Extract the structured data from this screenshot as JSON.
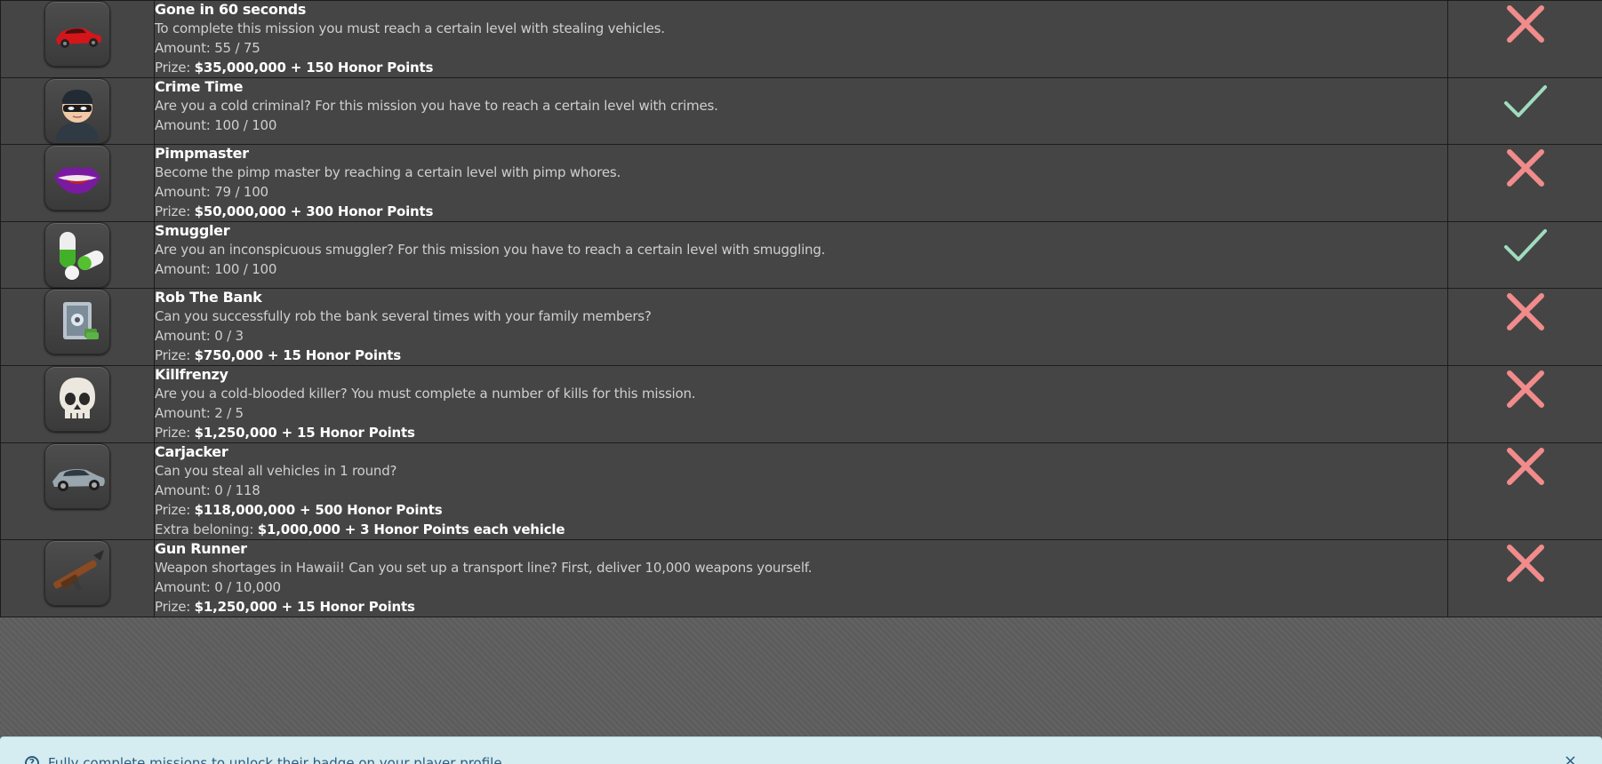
{
  "missions": [
    {
      "icon": "red-sports-car-icon",
      "title": "Gone in 60 seconds",
      "description": "To complete this mission you must reach a certain level with stealing vehicles.",
      "amount_label": "Amount:",
      "amount": "55 / 75",
      "prize_label": "Prize:",
      "prize": "$35,000,000 + 150 Honor Points",
      "status": "incomplete-x-icon"
    },
    {
      "icon": "masked-criminal-icon",
      "title": "Crime Time",
      "description": "Are you a cold criminal? For this mission you have to reach a certain level with crimes.",
      "amount_label": "Amount:",
      "amount": "100 / 100",
      "status": "complete-check-icon"
    },
    {
      "icon": "purple-lips-icon",
      "title": "Pimpmaster",
      "description": "Become the pimp master by reaching a certain level with pimp whores.",
      "amount_label": "Amount:",
      "amount": "79 / 100",
      "prize_label": "Prize:",
      "prize": "$50,000,000 + 300 Honor Points",
      "status": "incomplete-x-icon"
    },
    {
      "icon": "pills-icon",
      "title": "Smuggler",
      "description": "Are you an inconspicuous smuggler? For this mission you have to reach a certain level with smuggling.",
      "amount_label": "Amount:",
      "amount": "100 / 100",
      "status": "complete-check-icon"
    },
    {
      "icon": "bank-safe-icon",
      "title": "Rob The Bank",
      "description": "Can you successfully rob the bank several times with your family members?",
      "amount_label": "Amount:",
      "amount": "0 / 3",
      "prize_label": "Prize:",
      "prize": "$750,000 + 15 Honor Points",
      "status": "incomplete-x-icon"
    },
    {
      "icon": "skull-icon",
      "title": "Killfrenzy",
      "description": "Are you a cold-blooded killer? You must complete a number of kills for this mission.",
      "amount_label": "Amount:",
      "amount": "2 / 5",
      "prize_label": "Prize:",
      "prize": "$1,250,000 + 15 Honor Points",
      "status": "incomplete-x-icon"
    },
    {
      "icon": "silver-sports-car-icon",
      "title": "Carjacker",
      "description": "Can you steal all vehicles in 1 round?",
      "amount_label": "Amount:",
      "amount": "0 / 118",
      "prize_label": "Prize:",
      "prize": "$118,000,000 + 500 Honor Points",
      "extra_label": "Extra beloning:",
      "extra": "$1,000,000 + 3 Honor Points each vehicle",
      "status": "incomplete-x-icon"
    },
    {
      "icon": "rocket-launcher-icon",
      "title": "Gun Runner",
      "description": "Weapon shortages in Hawaii! Can you set up a transport line? First, deliver 10,000 weapons yourself.",
      "amount_label": "Amount:",
      "amount": "0 / 10,000",
      "prize_label": "Prize:",
      "prize": "$1,250,000 + 15 Honor Points",
      "status": "incomplete-x-icon"
    }
  ],
  "info_bar": {
    "icon": "info-circle-icon",
    "text": "Fully complete missions to unlock their badge on your player profile.",
    "close": "×"
  },
  "colors": {
    "row_bg": "#454545",
    "x_color": "#f28b8b",
    "check_color": "#9fdcbf",
    "info_bg": "#d5ecf1",
    "info_text": "#2b5d7d"
  }
}
